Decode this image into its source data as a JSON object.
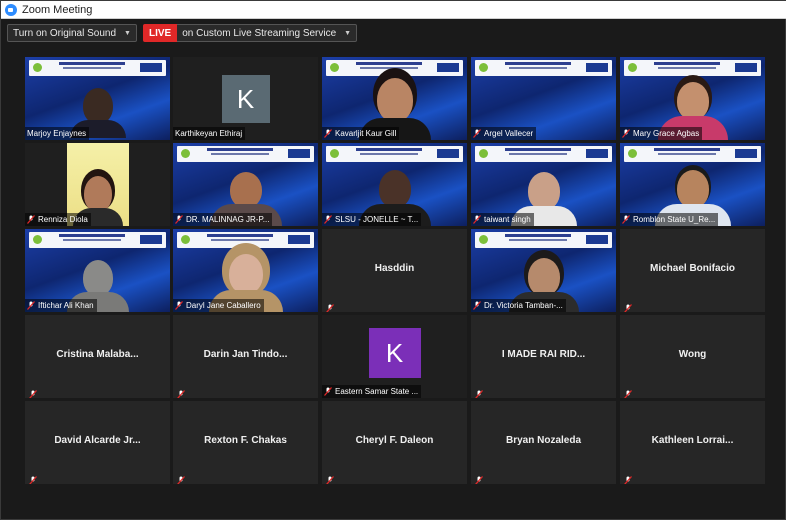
{
  "window": {
    "title": "Zoom Meeting"
  },
  "toolbar": {
    "original_sound_label": "Turn on Original Sound",
    "live_badge": "LIVE",
    "streaming_label": "on Custom Live Streaming Service"
  },
  "colors": {
    "active_speaker": "#c5e02a",
    "live_red": "#e02828",
    "muted_mic": "#e02828"
  },
  "tiles": [
    {
      "name": "Marjoy Enjaynes"
    },
    {
      "name": "Karthikeyan Ethiraj",
      "avatar_letter": "K"
    },
    {
      "name": "Kavarljit Kaur Gill"
    },
    {
      "name": "Argel Vallecer"
    },
    {
      "name": "Mary Grace Agbas"
    },
    {
      "name": "Renniza Diola"
    },
    {
      "name": "DR. MALINNAG JR-P..."
    },
    {
      "name": "SLSU - JONELLE ~ T..."
    },
    {
      "name": "taiwant singh"
    },
    {
      "name": "Romblon State U_Re..."
    },
    {
      "name": "Iftichar Ali Khan"
    },
    {
      "name": "Daryl Jane Caballero"
    },
    {
      "name": "Hasddin"
    },
    {
      "name": "Dr. Victoria Tamban-..."
    },
    {
      "name": "Michael Bonifacio"
    },
    {
      "name": "Cristina  Malaba..."
    },
    {
      "name": "Darin Jan Tindo..."
    },
    {
      "name": "Eastern Samar State ...",
      "avatar_letter": "K"
    },
    {
      "name": "I MADE RAI RID..."
    },
    {
      "name": "Wong"
    },
    {
      "name": "David Alcarde Jr..."
    },
    {
      "name": "Rexton F. Chakas"
    },
    {
      "name": "Cheryl F. Daleon"
    },
    {
      "name": "Bryan Nozaleda"
    },
    {
      "name": "Kathleen  Lorrai..."
    }
  ]
}
